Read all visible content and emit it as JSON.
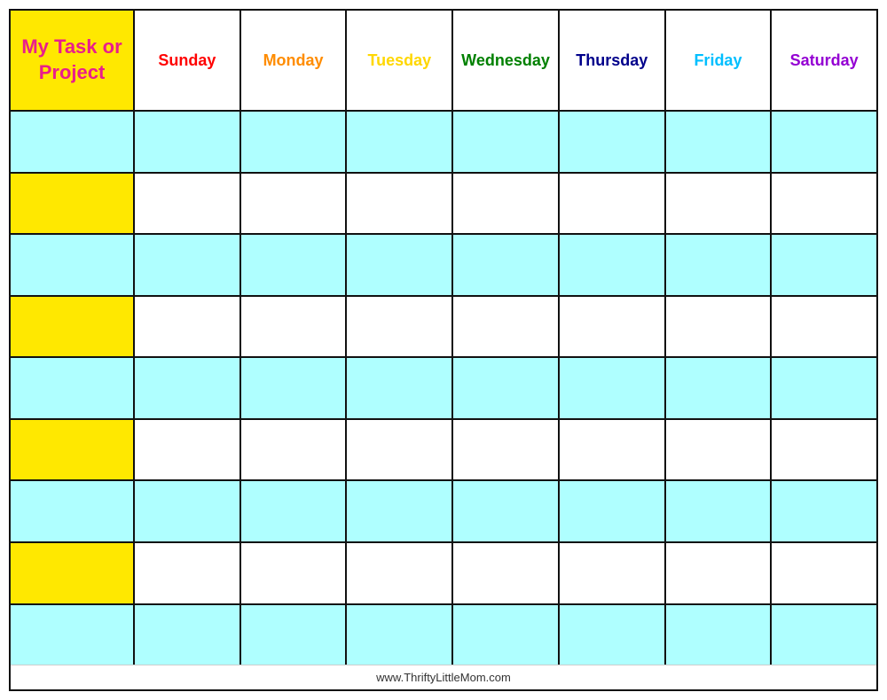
{
  "header": {
    "task_label_line1": "My Task or",
    "task_label_line2": "Project"
  },
  "days": [
    {
      "label": "Sunday",
      "class": "sunday"
    },
    {
      "label": "Monday",
      "class": "monday"
    },
    {
      "label": "Tuesday",
      "class": "tuesday"
    },
    {
      "label": "Wednesday",
      "class": "wednesday"
    },
    {
      "label": "Thursday",
      "class": "thursday"
    },
    {
      "label": "Friday",
      "class": "friday"
    },
    {
      "label": "Saturday",
      "class": "saturday"
    }
  ],
  "rows": [
    {
      "task_color": "cyan",
      "day_style": "row-cyan"
    },
    {
      "task_color": "yellow",
      "day_style": "row-white"
    },
    {
      "task_color": "cyan",
      "day_style": "row-cyan"
    },
    {
      "task_color": "yellow",
      "day_style": "row-white"
    },
    {
      "task_color": "cyan",
      "day_style": "row-cyan"
    },
    {
      "task_color": "yellow",
      "day_style": "row-white"
    },
    {
      "task_color": "cyan",
      "day_style": "row-cyan"
    },
    {
      "task_color": "yellow",
      "day_style": "row-white"
    },
    {
      "task_color": "cyan",
      "day_style": "row-cyan"
    }
  ],
  "footer": {
    "url": "www.ThriftyLittleMom.com"
  }
}
